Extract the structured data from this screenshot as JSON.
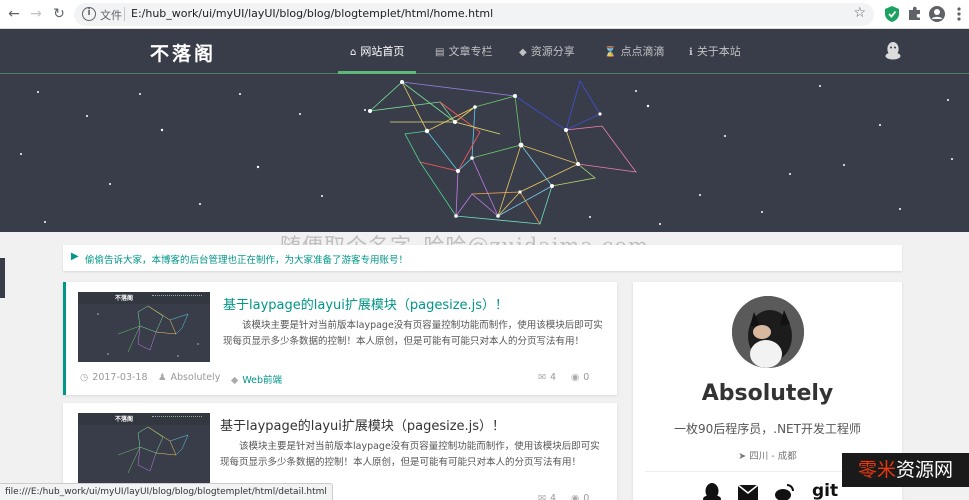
{
  "browser": {
    "scheme_label": "文件",
    "url": "E:/hub_work/ui/myUI/layUI/blog/blog/blogtemplet/html/home.html",
    "icons": [
      "back-icon",
      "forward-icon",
      "reload-icon",
      "info-icon",
      "star-icon",
      "shield-extension-icon",
      "puzzle-extension-icon",
      "account-icon",
      "menu-icon"
    ]
  },
  "site": {
    "logo": "不落阁",
    "nav": [
      {
        "icon": "home-icon",
        "label": "网站首页",
        "active": true
      },
      {
        "icon": "file-icon",
        "label": "文章专栏",
        "active": false
      },
      {
        "icon": "tag-icon",
        "label": "资源分享",
        "active": false
      },
      {
        "icon": "hourglass-icon",
        "label": "点点滴滴",
        "active": false
      },
      {
        "icon": "info-icon",
        "label": "关于本站",
        "active": false
      }
    ]
  },
  "watermark": "随便取个名字_哈哈@zuidaima.com",
  "notice": {
    "text": "偷偷告诉大家，本博客的后台管理也正在制作，为大家准备了游客专用账号！"
  },
  "articles": [
    {
      "title": "基于laypage的layui扩展模块（pagesize.js）！",
      "summary": "该模块主要是针对当前版本laypage没有页容量控制功能而制作，使用该模块后即可实现每页显示多少条数据的控制！本人原创，但是可能有可能只对本人的分页写法有用！",
      "date": "2017-03-18",
      "author": "Absolutely",
      "tag": "Web前端",
      "comments": "4",
      "views": "0",
      "thumb_logo": "不落阁"
    },
    {
      "title": "基于laypage的layui扩展模块（pagesize.js）！",
      "summary": "该模块主要是针对当前版本laypage没有页容量控制功能而制作，使用该模块后即可实现每页显示多少条数据的控制！本人原创，但是可能有可能只对本人的分页写法有用！",
      "comments": "4",
      "views": "0",
      "thumb_logo": "不落阁"
    }
  ],
  "author": {
    "name": "Absolutely",
    "bio": "一枚90后程序员，.NET开发工程师",
    "location": "四川 - 成都",
    "socials": [
      "qq-icon",
      "email-icon",
      "weibo-icon",
      "git"
    ]
  },
  "status_bar": "file:///E:/hub_work/ui/myUI/layUI/blog/blog/blogtemplet/html/detail.html",
  "overlay_badge": {
    "part1": "零米",
    "part2": "资源网"
  },
  "colors": {
    "header_bg": "#393d49",
    "accent": "#009688",
    "nav_active_bar": "#5FB878"
  }
}
